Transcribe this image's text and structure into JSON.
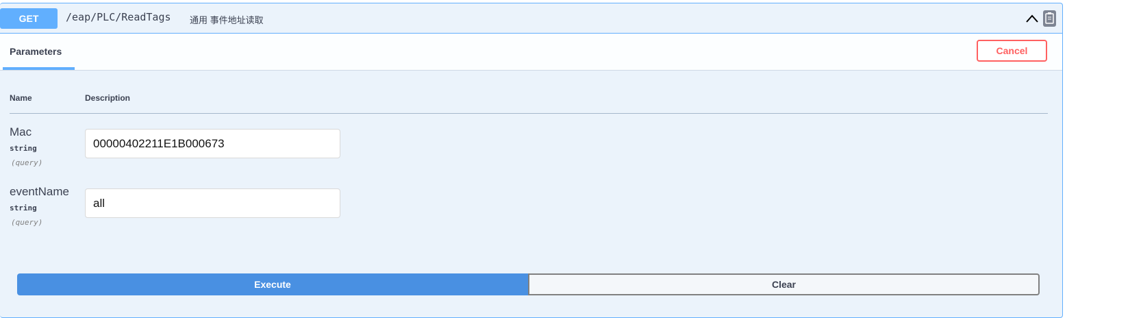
{
  "operation": {
    "method": "GET",
    "path": "/eap/PLC/ReadTags",
    "summary": "通用 事件地址读取",
    "accent_color": "#61affe"
  },
  "icons": {
    "collapse": "chevron-up-icon",
    "copy": "clipboard-copy-icon"
  },
  "tabs": {
    "parameters_label": "Parameters",
    "cancel_label": "Cancel"
  },
  "table": {
    "name_header": "Name",
    "description_header": "Description",
    "params": [
      {
        "name": "Mac",
        "type": "string",
        "in": "(query)",
        "value": "00000402211E1B000673"
      },
      {
        "name": "eventName",
        "type": "string",
        "in": "(query)",
        "value": "all"
      }
    ]
  },
  "actions": {
    "execute_label": "Execute",
    "clear_label": "Clear",
    "execute_color": "#4990e2"
  }
}
